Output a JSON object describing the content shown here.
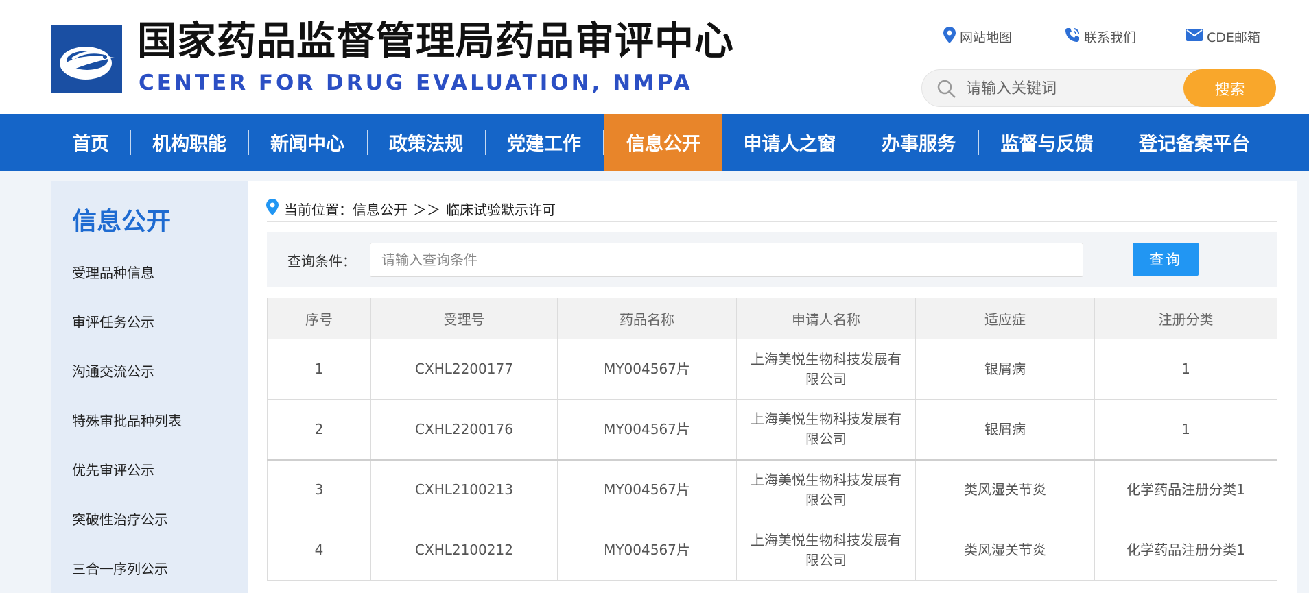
{
  "header": {
    "title_cn": "国家药品监督管理局药品审评中心",
    "title_en": "CENTER FOR DRUG EVALUATION, NMPA",
    "links": [
      {
        "label": "网站地图",
        "icon": "location-pin-icon"
      },
      {
        "label": "联系我们",
        "icon": "phone-icon"
      },
      {
        "label": "CDE邮箱",
        "icon": "mail-icon"
      }
    ],
    "search": {
      "placeholder": "请输入关键词",
      "button": "搜索"
    }
  },
  "nav": {
    "items": [
      "首页",
      "机构职能",
      "新闻中心",
      "政策法规",
      "党建工作",
      "信息公开",
      "申请人之窗",
      "办事服务",
      "监督与反馈",
      "登记备案平台"
    ],
    "active": "信息公开"
  },
  "sidebar": {
    "title": "信息公开",
    "items": [
      "受理品种信息",
      "审评任务公示",
      "沟通交流公示",
      "特殊审批品种列表",
      "优先审评公示",
      "突破性治疗公示",
      "三合一序列公示"
    ]
  },
  "breadcrumb": {
    "prefix": "当前位置：",
    "parent": "信息公开",
    "separator": "＞＞",
    "current": "临床试验默示许可"
  },
  "query": {
    "label": "查询条件：",
    "placeholder": "请输入查询条件",
    "button": "查询"
  },
  "table": {
    "columns": [
      "序号",
      "受理号",
      "药品名称",
      "申请人名称",
      "适应症",
      "注册分类"
    ],
    "rows": [
      {
        "no": "1",
        "accept_no": "CXHL2200177",
        "drug": "MY004567片",
        "applicant": "上海美悦生物科技发展有限公司",
        "indication": "银屑病",
        "category": "1"
      },
      {
        "no": "2",
        "accept_no": "CXHL2200176",
        "drug": "MY004567片",
        "applicant": "上海美悦生物科技发展有限公司",
        "indication": "银屑病",
        "category": "1"
      },
      {
        "no": "3",
        "accept_no": "CXHL2100213",
        "drug": "MY004567片",
        "applicant": "上海美悦生物科技发展有限公司",
        "indication": "类风湿关节炎",
        "category": "化学药品注册分类1"
      },
      {
        "no": "4",
        "accept_no": "CXHL2100212",
        "drug": "MY004567片",
        "applicant": "上海美悦生物科技发展有限公司",
        "indication": "类风湿关节炎",
        "category": "化学药品注册分类1"
      }
    ]
  },
  "colors": {
    "nav_bg": "#1565c8",
    "nav_active": "#e8852a",
    "search_button": "#f9a72b",
    "query_button": "#2196f3",
    "sidebar_title": "#1e6bd1",
    "title_en": "#2b4fc4",
    "logo_bg": "#1a4fa3"
  }
}
